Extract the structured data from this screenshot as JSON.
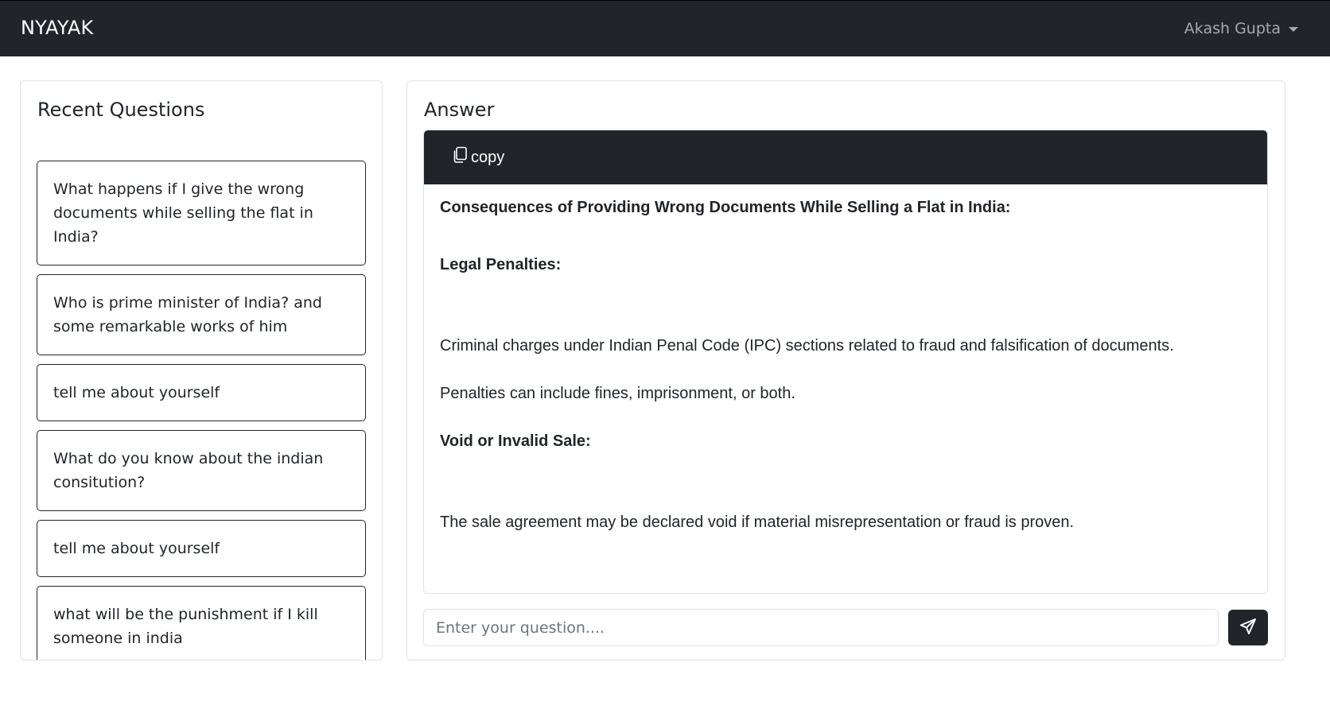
{
  "navbar": {
    "brand": "NYAYAK",
    "user_name": "Akash Gupta"
  },
  "recent": {
    "title": "Recent Questions",
    "questions": [
      "What happens if I give the wrong documents while selling the flat in India?",
      "Who is prime minister of India? and some remarkable works of him",
      "tell me about yourself",
      "What do you know about the indian consitution?",
      "tell me about yourself",
      "what will be the punishment if I kill someone in india"
    ]
  },
  "answer": {
    "title": "Answer",
    "copy_label": "copy",
    "lines": [
      "Consequences of Providing Wrong Documents While Selling a Flat in India:",
      "Legal Penalties:",
      "Criminal charges under Indian Penal Code (IPC) sections related to fraud and falsification of documents.",
      "Penalties can include fines, imprisonment, or both.",
      "Void or Invalid Sale:",
      "The sale agreement may be declared void if material misrepresentation or fraud is proven."
    ]
  },
  "input": {
    "placeholder": "Enter your question...."
  },
  "colors": {
    "navbar_bg": "#212529",
    "border": "#dee2e6"
  },
  "icons": {
    "copy": "copy-icon",
    "send": "send-icon",
    "dropdown": "chevron-down-icon"
  }
}
